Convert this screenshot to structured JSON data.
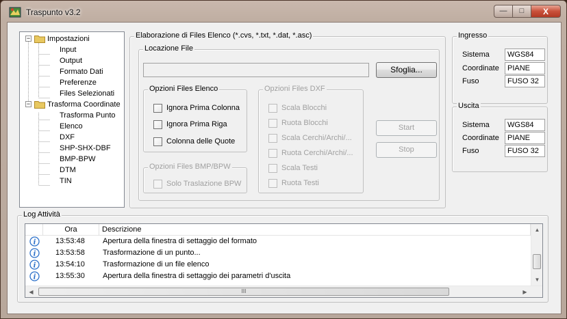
{
  "window": {
    "title": "Traspunto v3.2",
    "minimize_glyph": "—",
    "maximize_glyph": "□",
    "close_glyph": "X"
  },
  "tree": {
    "groups": [
      {
        "label": "Impostazioni",
        "expander": "−",
        "items": [
          "Input",
          "Output",
          "Formato Dati",
          "Preferenze",
          "Files Selezionati"
        ]
      },
      {
        "label": "Trasforma Coordinate",
        "expander": "−",
        "items": [
          "Trasforma Punto",
          "Elenco",
          "DXF",
          "SHP-SHX-DBF",
          "BMP-BPW",
          "DTM",
          "TIN"
        ]
      }
    ]
  },
  "elaborazione": {
    "title": "Elaborazione di Files Elenco (*.cvs, *.txt, *.dat, *.asc)",
    "locazione": {
      "title": "Locazione File",
      "path_value": "",
      "browse_label": "Sfoglia..."
    },
    "opzioni_elenco": {
      "title": "Opzioni Files Elenco",
      "options": [
        "Ignora Prima Colonna",
        "Ignora Prima Riga",
        "Colonna delle Quote"
      ]
    },
    "opzioni_dxf": {
      "title": "Opzioni Files DXF",
      "options": [
        "Scala Blocchi",
        "Ruota Blocchi",
        "Scala Cerchi/Archi/...",
        "Ruota Cerchi/Archi/...",
        "Scala Testi",
        "Ruota Testi"
      ]
    },
    "opzioni_bmp": {
      "title": "Opzioni Files BMP/BPW",
      "options": [
        "Solo Traslazione BPW"
      ]
    },
    "start_label": "Start",
    "stop_label": "Stop"
  },
  "ingresso": {
    "title": "Ingresso",
    "rows": [
      {
        "label": "Sistema",
        "value": "WGS84"
      },
      {
        "label": "Coordinate",
        "value": "PIANE"
      },
      {
        "label": "Fuso",
        "value": "FUSO 32"
      }
    ]
  },
  "uscita": {
    "title": "Uscita",
    "rows": [
      {
        "label": "Sistema",
        "value": "WGS84"
      },
      {
        "label": "Coordinate",
        "value": "PIANE"
      },
      {
        "label": "Fuso",
        "value": "FUSO 32"
      }
    ]
  },
  "log": {
    "title": "Log Attività",
    "columns": [
      "Ora",
      "Descrizione"
    ],
    "entries": [
      {
        "time": "13:53:48",
        "text": "Apertura della finestra di settaggio del formato"
      },
      {
        "time": "13:53:58",
        "text": "Trasformazione di un punto..."
      },
      {
        "time": "13:54:10",
        "text": "Trasformazione di un file elenco"
      },
      {
        "time": "13:55:30",
        "text": "Apertura della finestra di settaggio dei parametri d'uscita"
      }
    ],
    "scroll_grip": "III"
  },
  "colors": {
    "folder": "#e8c860",
    "info_icon": "#2a6fc9",
    "close_button": "#c9503a"
  }
}
